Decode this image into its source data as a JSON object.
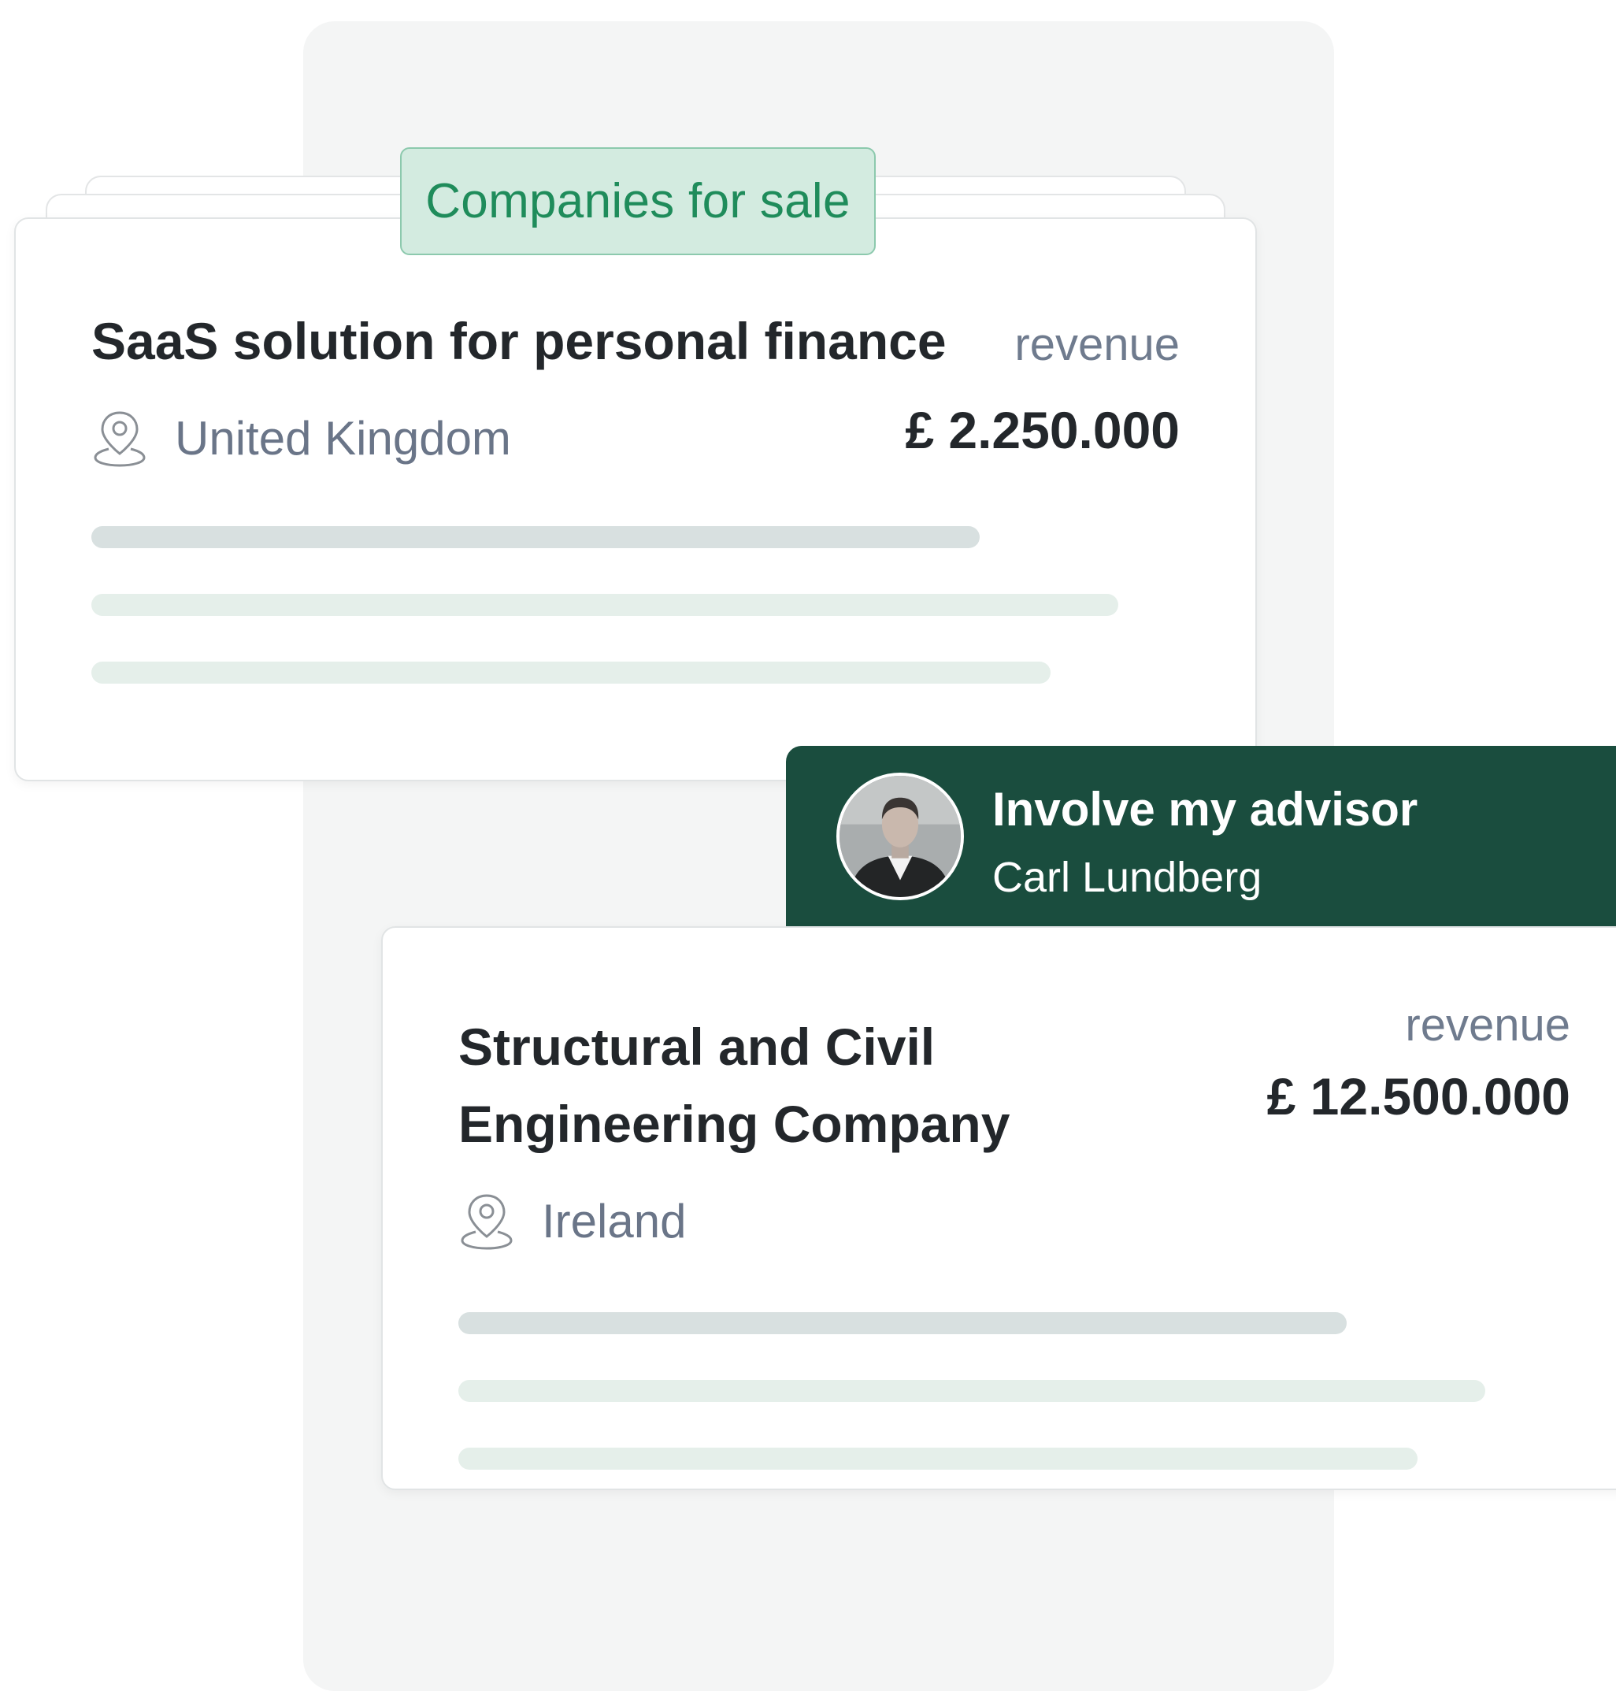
{
  "tag": {
    "label": "Companies for sale"
  },
  "listings": [
    {
      "title": "SaaS solution for personal finance",
      "location": "United Kingdom",
      "revenue_label": "revenue",
      "revenue_value": "£ 2.250.000"
    },
    {
      "title": "Structural and Civil Engineering Company",
      "location": "Ireland",
      "revenue_label": "revenue",
      "revenue_value": "£ 12.500.000"
    }
  ],
  "advisor": {
    "heading": "Involve my advisor",
    "name": "Carl Lundberg"
  },
  "icons": {
    "location": "location-pin-icon"
  },
  "colors": {
    "tag_background": "#d3ebe0",
    "tag_text": "#1f8c5b",
    "advisor_background": "#1a4d3e",
    "title_text": "#23272b",
    "secondary_text": "#6a7588"
  }
}
